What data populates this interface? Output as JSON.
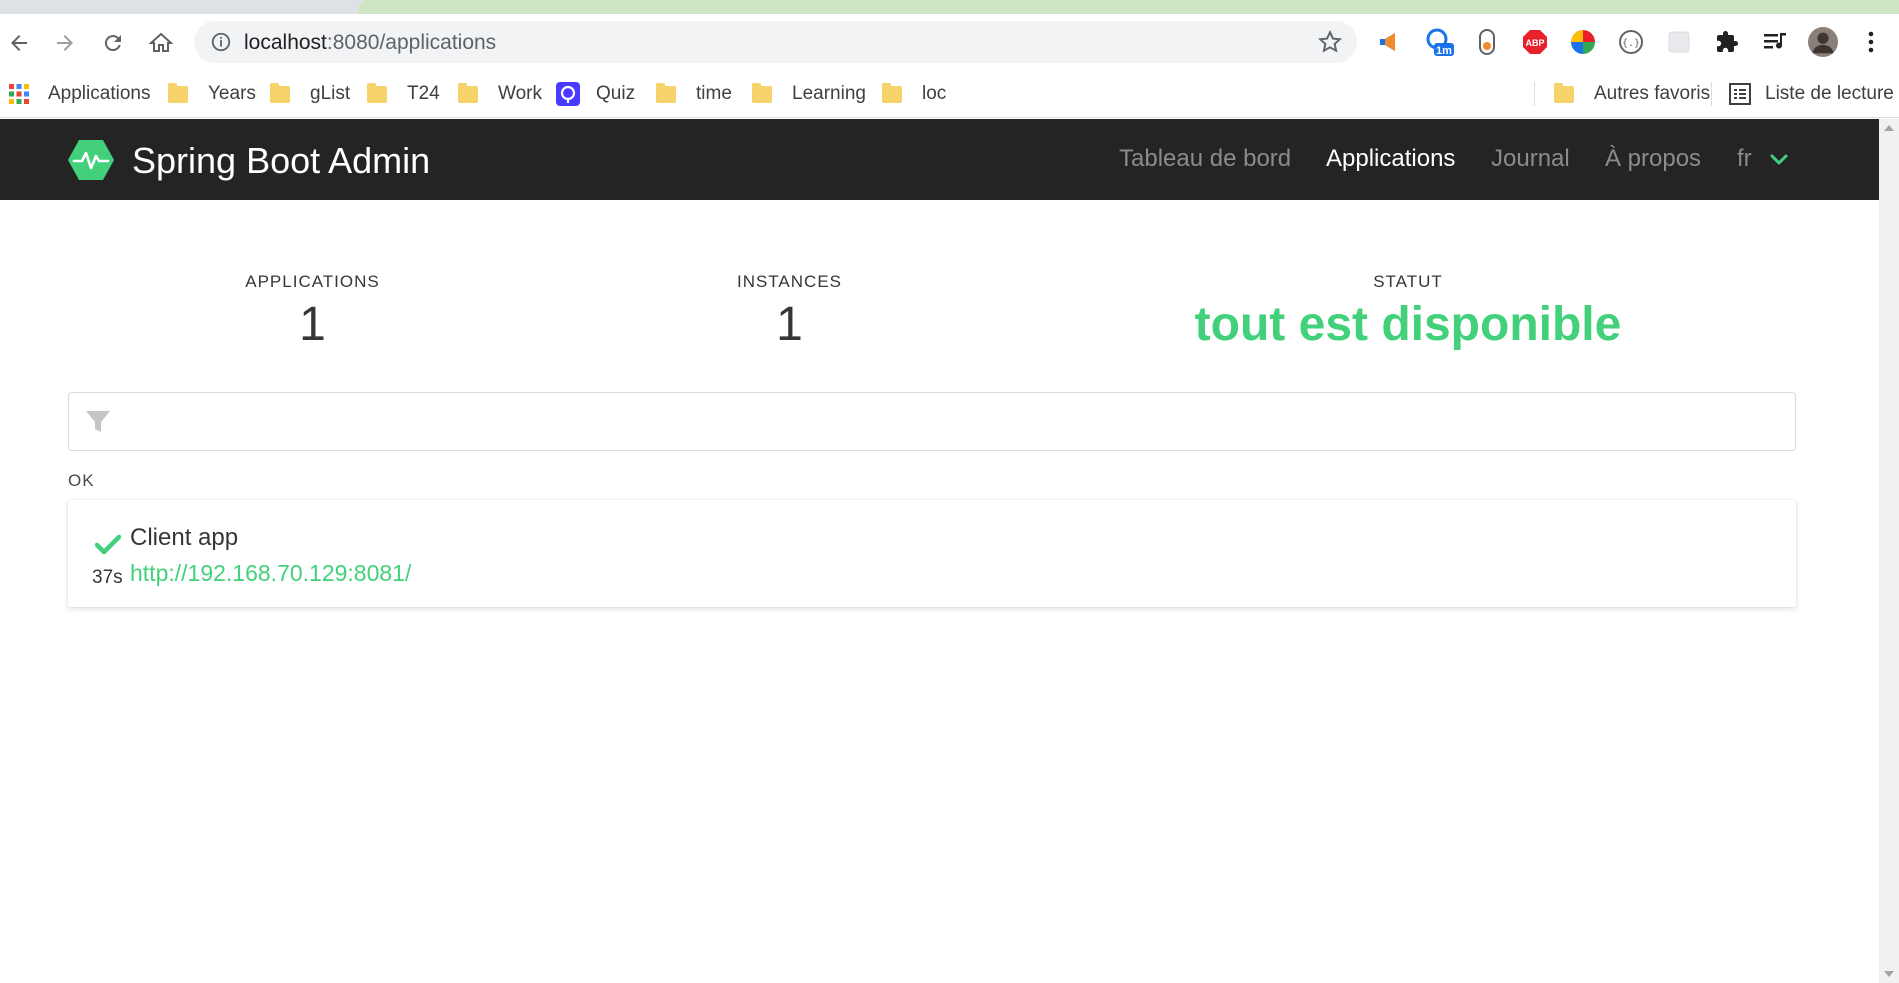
{
  "browser": {
    "url_host": "localhost",
    "url_path": ":8080/applications",
    "bookmarks": [
      {
        "label": "Applications",
        "icon": "apps-grid-icon"
      },
      {
        "label": "Years",
        "icon": "folder-icon"
      },
      {
        "label": "gList",
        "icon": "folder-icon"
      },
      {
        "label": "T24",
        "icon": "folder-icon"
      },
      {
        "label": "Work",
        "icon": "folder-icon"
      },
      {
        "label": "Quiz",
        "icon": "quiz-icon"
      },
      {
        "label": "time",
        "icon": "folder-icon"
      },
      {
        "label": "Learning",
        "icon": "folder-icon"
      },
      {
        "label": "loc",
        "icon": "folder-icon"
      }
    ],
    "other_bookmarks": "Autres favoris",
    "reading_list": "Liste de lecture",
    "extension_badge": "1m",
    "adblock_label": "ABP"
  },
  "sba": {
    "title": "Spring Boot Admin",
    "nav": {
      "dashboard": "Tableau de bord",
      "applications": "Applications",
      "journal": "Journal",
      "about": "À propos",
      "lang": "fr"
    },
    "stats": {
      "applications_label": "APPLICATIONS",
      "applications_value": "1",
      "instances_label": "INSTANCES",
      "instances_value": "1",
      "status_label": "STATUT",
      "status_value": "tout est disponible"
    },
    "filter": {
      "placeholder": ""
    },
    "group": {
      "label": "OK",
      "app": {
        "name": "Client app",
        "uptime": "37s",
        "url": "http://192.168.70.129:8081/"
      }
    }
  },
  "colors": {
    "accent_green": "#42d17a",
    "nav_bg": "#242424"
  }
}
